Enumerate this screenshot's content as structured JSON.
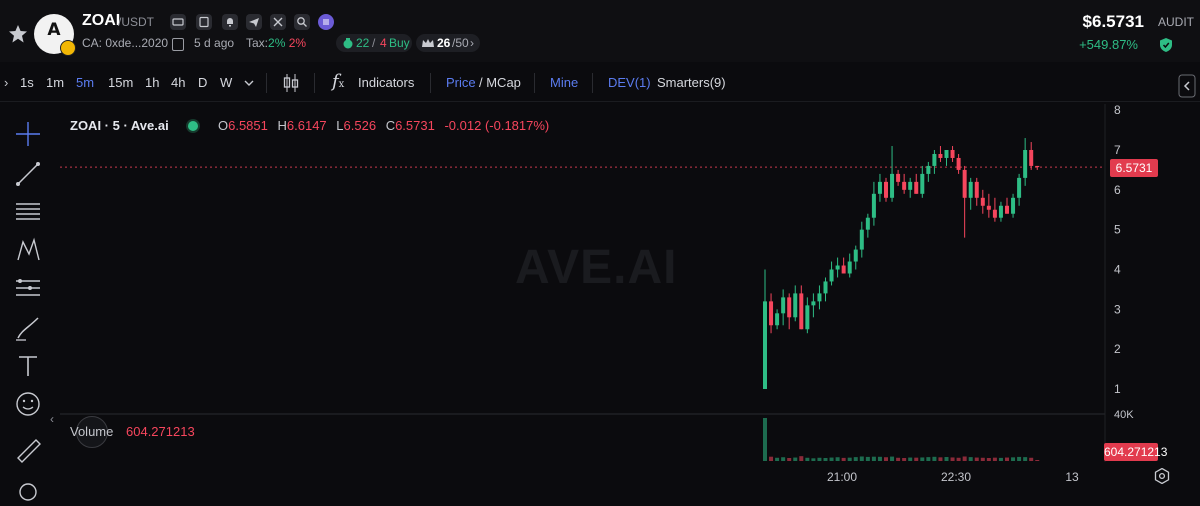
{
  "header": {
    "symbol": "ZOAI",
    "pair": "/USDT",
    "avatar_letter": "A",
    "contract": "CA: 0xde...2020",
    "age": "5 d ago",
    "tax_label": "Tax:",
    "tax_buy": "2%",
    "tax_sell": "2%",
    "buys": "22",
    "sells": "4",
    "buy_label": "Buy",
    "holders": "26",
    "holders_total": "/50",
    "price": "$6.5731",
    "change": "+549.87%",
    "audit_label": "AUDIT"
  },
  "toolbar": {
    "intervals": [
      "1s",
      "1m",
      "5m",
      "15m",
      "1h",
      "4h",
      "D",
      "W"
    ],
    "active_interval": "5m",
    "indicators": "Indicators",
    "price": "Price",
    "mcap": "/ MCap",
    "mine": "Mine",
    "dev": "DEV(1)",
    "smarters": "Smarters(9)"
  },
  "chart_title": {
    "name": "ZOAI · 5 · Ave.ai",
    "o_label": "O",
    "o": "6.5851",
    "h_label": "H",
    "h": "6.6147",
    "l_label": "L",
    "l": "6.526",
    "c_label": "C",
    "c": "6.5731",
    "diff": "-0.012 (-0.1817%)"
  },
  "watermark": "AVE.AI",
  "price_tag": "6.5731",
  "volume": {
    "label": "Volume",
    "value": "604.271213",
    "tag": "604.271213",
    "axis_label": "40K"
  },
  "colors": {
    "up": "#2ebd85",
    "down": "#f6465d",
    "accent": "#5b7cf0"
  },
  "chart_data": {
    "type": "candlestick",
    "yticks": [
      "8",
      "7",
      "6",
      "5",
      "4",
      "3",
      "2",
      "1"
    ],
    "xticks": [
      "21:00",
      "22:30",
      "13"
    ],
    "ylim": [
      0.5,
      8
    ],
    "candles": [
      {
        "o": 1.0,
        "h": 4.0,
        "l": 1.0,
        "c": 3.2
      },
      {
        "o": 3.2,
        "h": 3.4,
        "l": 2.4,
        "c": 2.6
      },
      {
        "o": 2.6,
        "h": 3.0,
        "l": 2.5,
        "c": 2.9
      },
      {
        "o": 2.9,
        "h": 3.5,
        "l": 2.6,
        "c": 3.3
      },
      {
        "o": 3.3,
        "h": 3.4,
        "l": 2.5,
        "c": 2.8
      },
      {
        "o": 2.8,
        "h": 3.6,
        "l": 2.7,
        "c": 3.4
      },
      {
        "o": 3.4,
        "h": 3.6,
        "l": 2.5,
        "c": 2.5
      },
      {
        "o": 2.5,
        "h": 3.3,
        "l": 2.4,
        "c": 3.1
      },
      {
        "o": 3.1,
        "h": 3.4,
        "l": 2.8,
        "c": 3.2
      },
      {
        "o": 3.2,
        "h": 3.6,
        "l": 3.0,
        "c": 3.4
      },
      {
        "o": 3.4,
        "h": 3.8,
        "l": 3.2,
        "c": 3.7
      },
      {
        "o": 3.7,
        "h": 4.2,
        "l": 3.6,
        "c": 4.0
      },
      {
        "o": 4.0,
        "h": 4.3,
        "l": 3.8,
        "c": 4.1
      },
      {
        "o": 4.1,
        "h": 4.3,
        "l": 3.9,
        "c": 3.9
      },
      {
        "o": 3.9,
        "h": 4.4,
        "l": 3.8,
        "c": 4.2
      },
      {
        "o": 4.2,
        "h": 4.6,
        "l": 4.0,
        "c": 4.5
      },
      {
        "o": 4.5,
        "h": 5.2,
        "l": 4.3,
        "c": 5.0
      },
      {
        "o": 5.0,
        "h": 5.4,
        "l": 4.8,
        "c": 5.3
      },
      {
        "o": 5.3,
        "h": 6.2,
        "l": 5.1,
        "c": 5.9
      },
      {
        "o": 5.9,
        "h": 6.4,
        "l": 5.7,
        "c": 6.2
      },
      {
        "o": 6.2,
        "h": 6.3,
        "l": 5.7,
        "c": 5.8
      },
      {
        "o": 5.8,
        "h": 7.1,
        "l": 5.7,
        "c": 6.4
      },
      {
        "o": 6.4,
        "h": 6.5,
        "l": 6.1,
        "c": 6.2
      },
      {
        "o": 6.2,
        "h": 6.4,
        "l": 5.9,
        "c": 6.0
      },
      {
        "o": 6.0,
        "h": 6.3,
        "l": 5.8,
        "c": 6.2
      },
      {
        "o": 6.2,
        "h": 6.4,
        "l": 5.9,
        "c": 5.9
      },
      {
        "o": 5.9,
        "h": 6.6,
        "l": 5.8,
        "c": 6.4
      },
      {
        "o": 6.4,
        "h": 6.7,
        "l": 6.2,
        "c": 6.6
      },
      {
        "o": 6.6,
        "h": 7.0,
        "l": 6.4,
        "c": 6.9
      },
      {
        "o": 6.9,
        "h": 7.1,
        "l": 6.7,
        "c": 6.8
      },
      {
        "o": 6.8,
        "h": 7.0,
        "l": 6.6,
        "c": 7.0
      },
      {
        "o": 7.0,
        "h": 7.1,
        "l": 6.7,
        "c": 6.8
      },
      {
        "o": 6.8,
        "h": 6.9,
        "l": 6.4,
        "c": 6.5
      },
      {
        "o": 6.5,
        "h": 6.6,
        "l": 4.8,
        "c": 5.8
      },
      {
        "o": 5.8,
        "h": 6.3,
        "l": 5.5,
        "c": 6.2
      },
      {
        "o": 6.2,
        "h": 6.3,
        "l": 5.6,
        "c": 5.8
      },
      {
        "o": 5.8,
        "h": 6.0,
        "l": 5.4,
        "c": 5.6
      },
      {
        "o": 5.6,
        "h": 5.9,
        "l": 5.3,
        "c": 5.5
      },
      {
        "o": 5.5,
        "h": 5.8,
        "l": 5.2,
        "c": 5.3
      },
      {
        "o": 5.3,
        "h": 5.7,
        "l": 5.2,
        "c": 5.6
      },
      {
        "o": 5.6,
        "h": 5.8,
        "l": 5.4,
        "c": 5.4
      },
      {
        "o": 5.4,
        "h": 5.9,
        "l": 5.3,
        "c": 5.8
      },
      {
        "o": 5.8,
        "h": 6.4,
        "l": 5.6,
        "c": 6.3
      },
      {
        "o": 6.3,
        "h": 7.3,
        "l": 6.1,
        "c": 7.0
      },
      {
        "o": 7.0,
        "h": 7.2,
        "l": 6.5,
        "c": 6.6
      },
      {
        "o": 6.6,
        "h": 6.6,
        "l": 6.5,
        "c": 6.57
      }
    ],
    "volume_max": 40000,
    "volumes": [
      40000,
      4000,
      3000,
      3500,
      2800,
      3200,
      4500,
      3000,
      2500,
      3000,
      2800,
      3200,
      3500,
      2900,
      3100,
      3600,
      4200,
      3800,
      4000,
      3900,
      3500,
      4100,
      3000,
      2800,
      3200,
      3100,
      3300,
      3600,
      3900,
      3400,
      3700,
      3300,
      3000,
      4200,
      3600,
      3200,
      3000,
      2800,
      3100,
      2900,
      3200,
      3400,
      3800,
      3600,
      3000,
      600
    ]
  }
}
